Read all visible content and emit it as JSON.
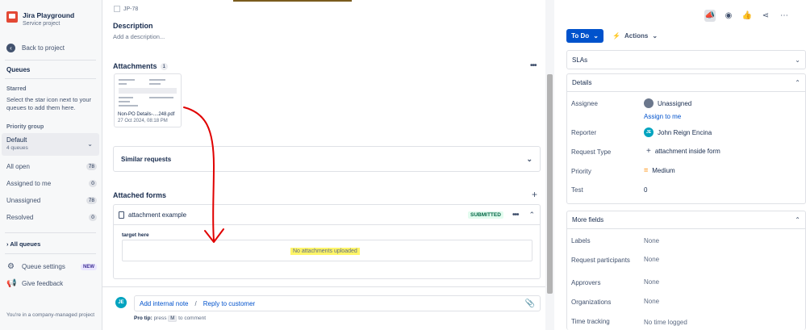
{
  "sidebar": {
    "project_name": "Jira Playground",
    "project_type": "Service project",
    "back_label": "Back to project",
    "queues_heading": "Queues",
    "starred_title": "Starred",
    "starred_desc": "Select the star icon next to your queues to add them here.",
    "priority_group_title": "Priority group",
    "priority_group_value": "Default",
    "priority_group_count": "4 queues",
    "queues": [
      {
        "label": "All open",
        "count": "78"
      },
      {
        "label": "Assigned to me",
        "count": "0"
      },
      {
        "label": "Unassigned",
        "count": "78"
      },
      {
        "label": "Resolved",
        "count": "0"
      }
    ],
    "all_queues": "All queues",
    "queue_settings": "Queue settings",
    "new_badge": "NEW",
    "give_feedback": "Give feedback",
    "managed_note": "You're in a company-managed project"
  },
  "main": {
    "issue_key": "JP-78",
    "description_title": "Description",
    "description_placeholder": "Add a description...",
    "attachments_title": "Attachments",
    "attachments_count": "1",
    "attachment": {
      "name": "Non-PO Details-....248.pdf",
      "date": "27 Oct 2024, 08:18 PM"
    },
    "similar_requests": "Similar requests",
    "attached_forms_title": "Attached forms",
    "form": {
      "name": "attachment example",
      "status": "SUBMITTED",
      "field_label": "target here",
      "empty_text": "No attachments uploaded"
    },
    "comment": {
      "avatar": "JE",
      "add_internal_note": "Add internal note",
      "separator": "/",
      "reply_to_customer": "Reply to customer",
      "pro_tip_label": "Pro tip:",
      "pro_tip_press": "press",
      "pro_tip_key": "M",
      "pro_tip_suffix": "to comment"
    }
  },
  "right": {
    "status_button": "To Do",
    "actions_button": "Actions",
    "slas_title": "SLAs",
    "details_title": "Details",
    "details": {
      "assignee_label": "Assignee",
      "assignee_value": "Unassigned",
      "assign_to_me": "Assign to me",
      "reporter_label": "Reporter",
      "reporter_avatar": "JE",
      "reporter_value": "John Reign Encina",
      "request_type_label": "Request Type",
      "request_type_value": "attachment inside form",
      "priority_label": "Priority",
      "priority_value": "Medium",
      "test_label": "Test",
      "test_value": "0"
    },
    "more_fields_title": "More fields",
    "more_fields": [
      {
        "label": "Labels",
        "value": "None"
      },
      {
        "label": "Request participants",
        "value": "None"
      },
      {
        "label": "Approvers",
        "value": "None"
      },
      {
        "label": "Organizations",
        "value": "None"
      },
      {
        "label": "Time tracking",
        "value": "No time logged"
      }
    ]
  },
  "colors": {
    "accent": "#0052cc",
    "annotation_arrow": "#e00000",
    "highlight": "#fff568"
  }
}
